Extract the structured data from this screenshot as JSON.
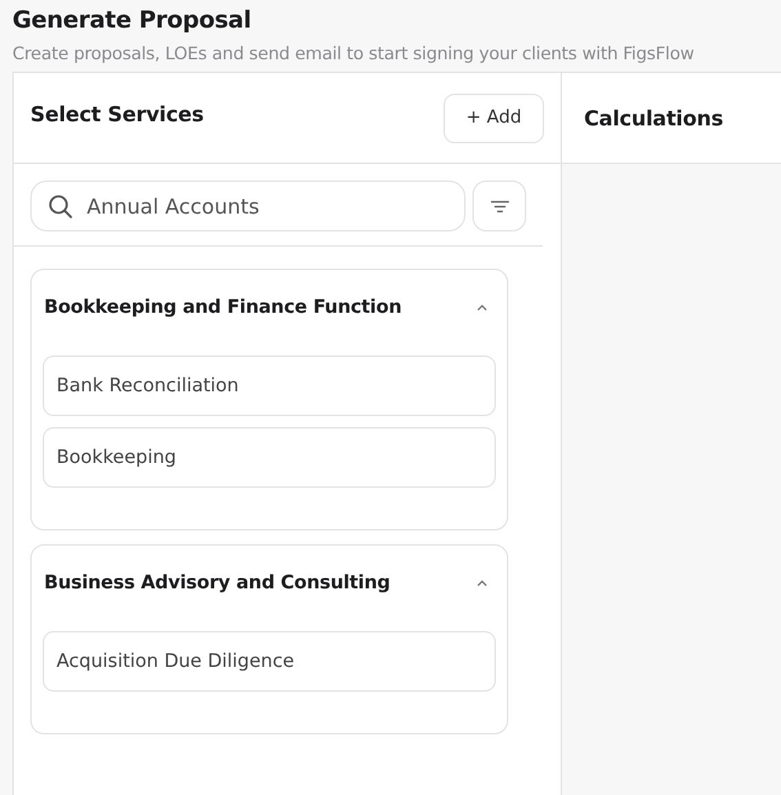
{
  "page": {
    "title": "Generate Proposal",
    "subtitle": "Create proposals, LOEs and send email to start signing your clients with FigsFlow"
  },
  "services_panel": {
    "title": "Select Services",
    "add_button": "+ Add",
    "search": {
      "value": "Annual Accounts"
    },
    "groups": [
      {
        "title": "Bookkeeping and Finance Function",
        "expanded": true,
        "items": [
          "Bank Reconciliation",
          "Bookkeeping"
        ]
      },
      {
        "title": "Business Advisory and Consulting",
        "expanded": true,
        "items": [
          "Acquisition Due Diligence"
        ]
      }
    ]
  },
  "calculations_panel": {
    "title": "Calculations"
  }
}
